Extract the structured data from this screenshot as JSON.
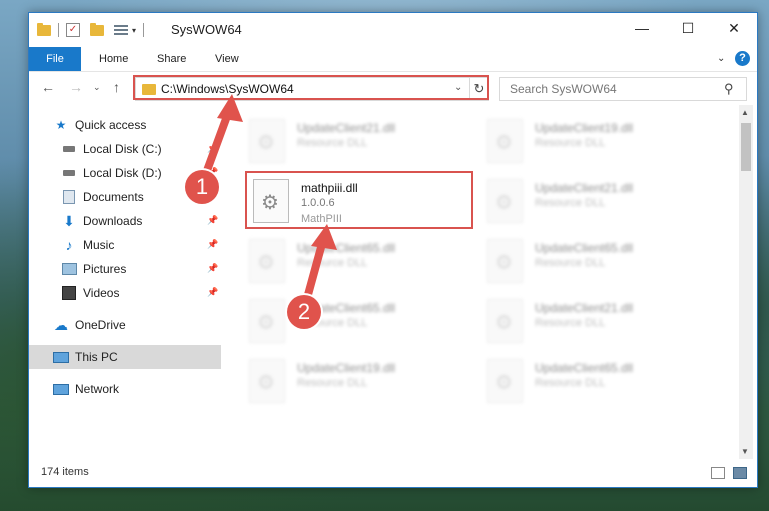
{
  "window": {
    "title": "SysWOW64",
    "controls": {
      "minimize": "—",
      "maximize": "☐",
      "close": "✕"
    }
  },
  "ribbon": {
    "tabs": [
      "File",
      "Home",
      "Share",
      "View"
    ],
    "help": "?"
  },
  "navigation": {
    "address": "C:\\Windows\\SysWOW64",
    "search_placeholder": "Search SysWOW64"
  },
  "sidebar": {
    "items": [
      {
        "label": "Quick access",
        "icon": "star-icon",
        "pinned": false
      },
      {
        "label": "Local Disk (C:)",
        "icon": "drive-icon",
        "pinned": true
      },
      {
        "label": "Local Disk (D:)",
        "icon": "drive-icon",
        "pinned": true
      },
      {
        "label": "Documents",
        "icon": "documents-icon",
        "pinned": true
      },
      {
        "label": "Downloads",
        "icon": "download-icon",
        "pinned": true
      },
      {
        "label": "Music",
        "icon": "music-icon",
        "pinned": true
      },
      {
        "label": "Pictures",
        "icon": "pictures-icon",
        "pinned": true
      },
      {
        "label": "Videos",
        "icon": "videos-icon",
        "pinned": true
      },
      {
        "label": "OneDrive",
        "icon": "cloud-icon",
        "pinned": false
      },
      {
        "label": "This PC",
        "icon": "pc-icon",
        "pinned": false,
        "selected": true
      },
      {
        "label": "Network",
        "icon": "network-icon",
        "pinned": false
      }
    ]
  },
  "files": {
    "focused": {
      "name": "mathpiii.dll",
      "version": "1.0.0.6",
      "description": "MathPIII"
    },
    "background": [
      {
        "name": "UpdateClient21.dll",
        "type": "Resource DLL"
      },
      {
        "name": "UpdateClient19.dll",
        "type": "Resource DLL"
      },
      {
        "name": "UpdateClient21.dll",
        "type": "Resource DLL"
      },
      {
        "name": "UpdateClient65.dll",
        "type": "Resource DLL"
      },
      {
        "name": "UpdateClient65.dll",
        "type": "Resource DLL"
      },
      {
        "name": "UpdateClient65.dll",
        "type": "Resource DLL"
      },
      {
        "name": "UpdateClient21.dll",
        "type": "Resource DLL"
      },
      {
        "name": "UpdateClient19.dll",
        "type": "Resource DLL"
      },
      {
        "name": "UpdateClient65.dll",
        "type": "Resource DLL"
      }
    ]
  },
  "status": {
    "item_count": "174 items"
  },
  "annotations": {
    "step1": "1",
    "step2": "2",
    "accent": "#e0534c"
  }
}
